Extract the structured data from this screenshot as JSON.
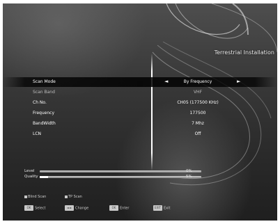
{
  "header": {
    "title": "Terrestrial Installation"
  },
  "settings": [
    {
      "label": "Scan Mode",
      "value": "By Frequency",
      "selected": true
    },
    {
      "label": "Scan Band",
      "value": "VHF",
      "dim": true
    },
    {
      "label": "Ch No.",
      "value": "CH05 (177500 KHz)"
    },
    {
      "label": "Frequency",
      "value": "177500"
    },
    {
      "label": "BandWidth",
      "value": "7 Mhz"
    },
    {
      "label": "LCN",
      "value": "Off"
    }
  ],
  "arrows": {
    "left": "◄",
    "right": "►"
  },
  "signal": {
    "level_label": "Level",
    "level_value": "0%",
    "level_fraction": 0.0,
    "quality_label": "Quality",
    "quality_value": "5%",
    "quality_fraction": 0.05
  },
  "hotkeys": {
    "blind_scan": "Blind Scan",
    "tp_scan": "TP Scan"
  },
  "buttons": {
    "select_key": "OK",
    "select_label": "Select",
    "change_key": "◄ ►",
    "change_label": "Change",
    "ok_key": "OK",
    "ok_label": "Enter",
    "exit_key": "EXIT",
    "exit_label": "Exit"
  }
}
